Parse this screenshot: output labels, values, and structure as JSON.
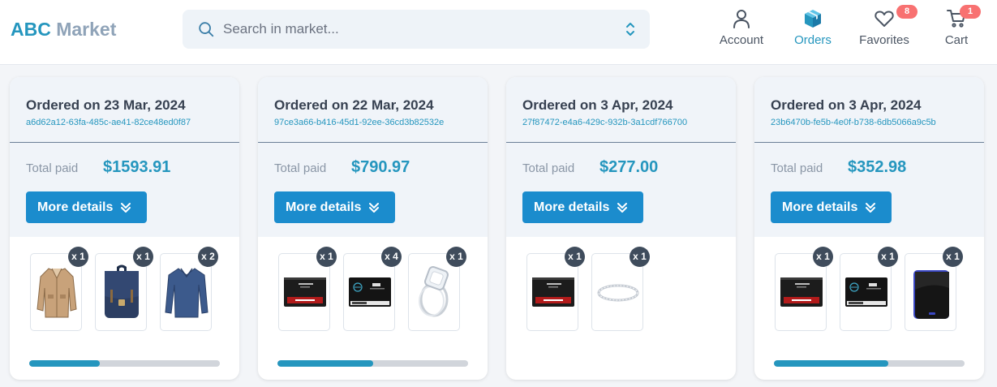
{
  "header": {
    "logo_a": "ABC",
    "logo_b": "Market",
    "search_placeholder": "Search in market...",
    "nav": [
      {
        "label": "Account",
        "icon": "user-icon"
      },
      {
        "label": "Orders",
        "icon": "box-icon",
        "active": true
      },
      {
        "label": "Favorites",
        "icon": "heart-icon",
        "badge": "8"
      },
      {
        "label": "Cart",
        "icon": "cart-icon",
        "badge": "1"
      }
    ]
  },
  "colors": {
    "accent": "#2596be",
    "button": "#1b8ccd",
    "badge": "#f87171",
    "qty_badge": "#3f4c5c"
  },
  "orders": [
    {
      "title": "Ordered on 23 Mar, 2024",
      "id": "a6d62a12-63fa-485c-ae41-82ce48ed0f87",
      "total_label": "Total paid",
      "total": "$1593.91",
      "button": "More details",
      "items": [
        {
          "product": "jacket-image",
          "qty": "x 1"
        },
        {
          "product": "backpack-image",
          "qty": "x 1"
        },
        {
          "product": "sweater-image",
          "qty": "x 2"
        }
      ],
      "progress": 0.37
    },
    {
      "title": "Ordered on 22 Mar, 2024",
      "id": "97ce3a66-b416-45d1-92ee-36cd3b82532e",
      "total_label": "Total paid",
      "total": "$790.97",
      "button": "More details",
      "items": [
        {
          "product": "sandisk-ssd-image",
          "qty": "x 1"
        },
        {
          "product": "silicon-power-ssd-image",
          "qty": "x 4"
        },
        {
          "product": "ring-image",
          "qty": "x 1"
        }
      ],
      "progress": 0.5
    },
    {
      "title": "Ordered on 3 Apr, 2024",
      "id": "27f87472-e4a6-429c-932b-3a1cdf766700",
      "total_label": "Total paid",
      "total": "$277.00",
      "button": "More details",
      "items": [
        {
          "product": "sandisk-ssd-image",
          "qty": "x 1"
        },
        {
          "product": "bracelet-image",
          "qty": "x 1"
        }
      ]
    },
    {
      "title": "Ordered on 3 Apr, 2024",
      "id": "23b6470b-fe5b-4e0f-b738-6db5066a9c5b",
      "total_label": "Total paid",
      "total": "$352.98",
      "button": "More details",
      "items": [
        {
          "product": "sandisk-ssd-image",
          "qty": "x 1"
        },
        {
          "product": "silicon-power-ssd-image",
          "qty": "x 1"
        },
        {
          "product": "external-hdd-image",
          "qty": "x 1"
        }
      ],
      "progress": 0.6
    }
  ]
}
